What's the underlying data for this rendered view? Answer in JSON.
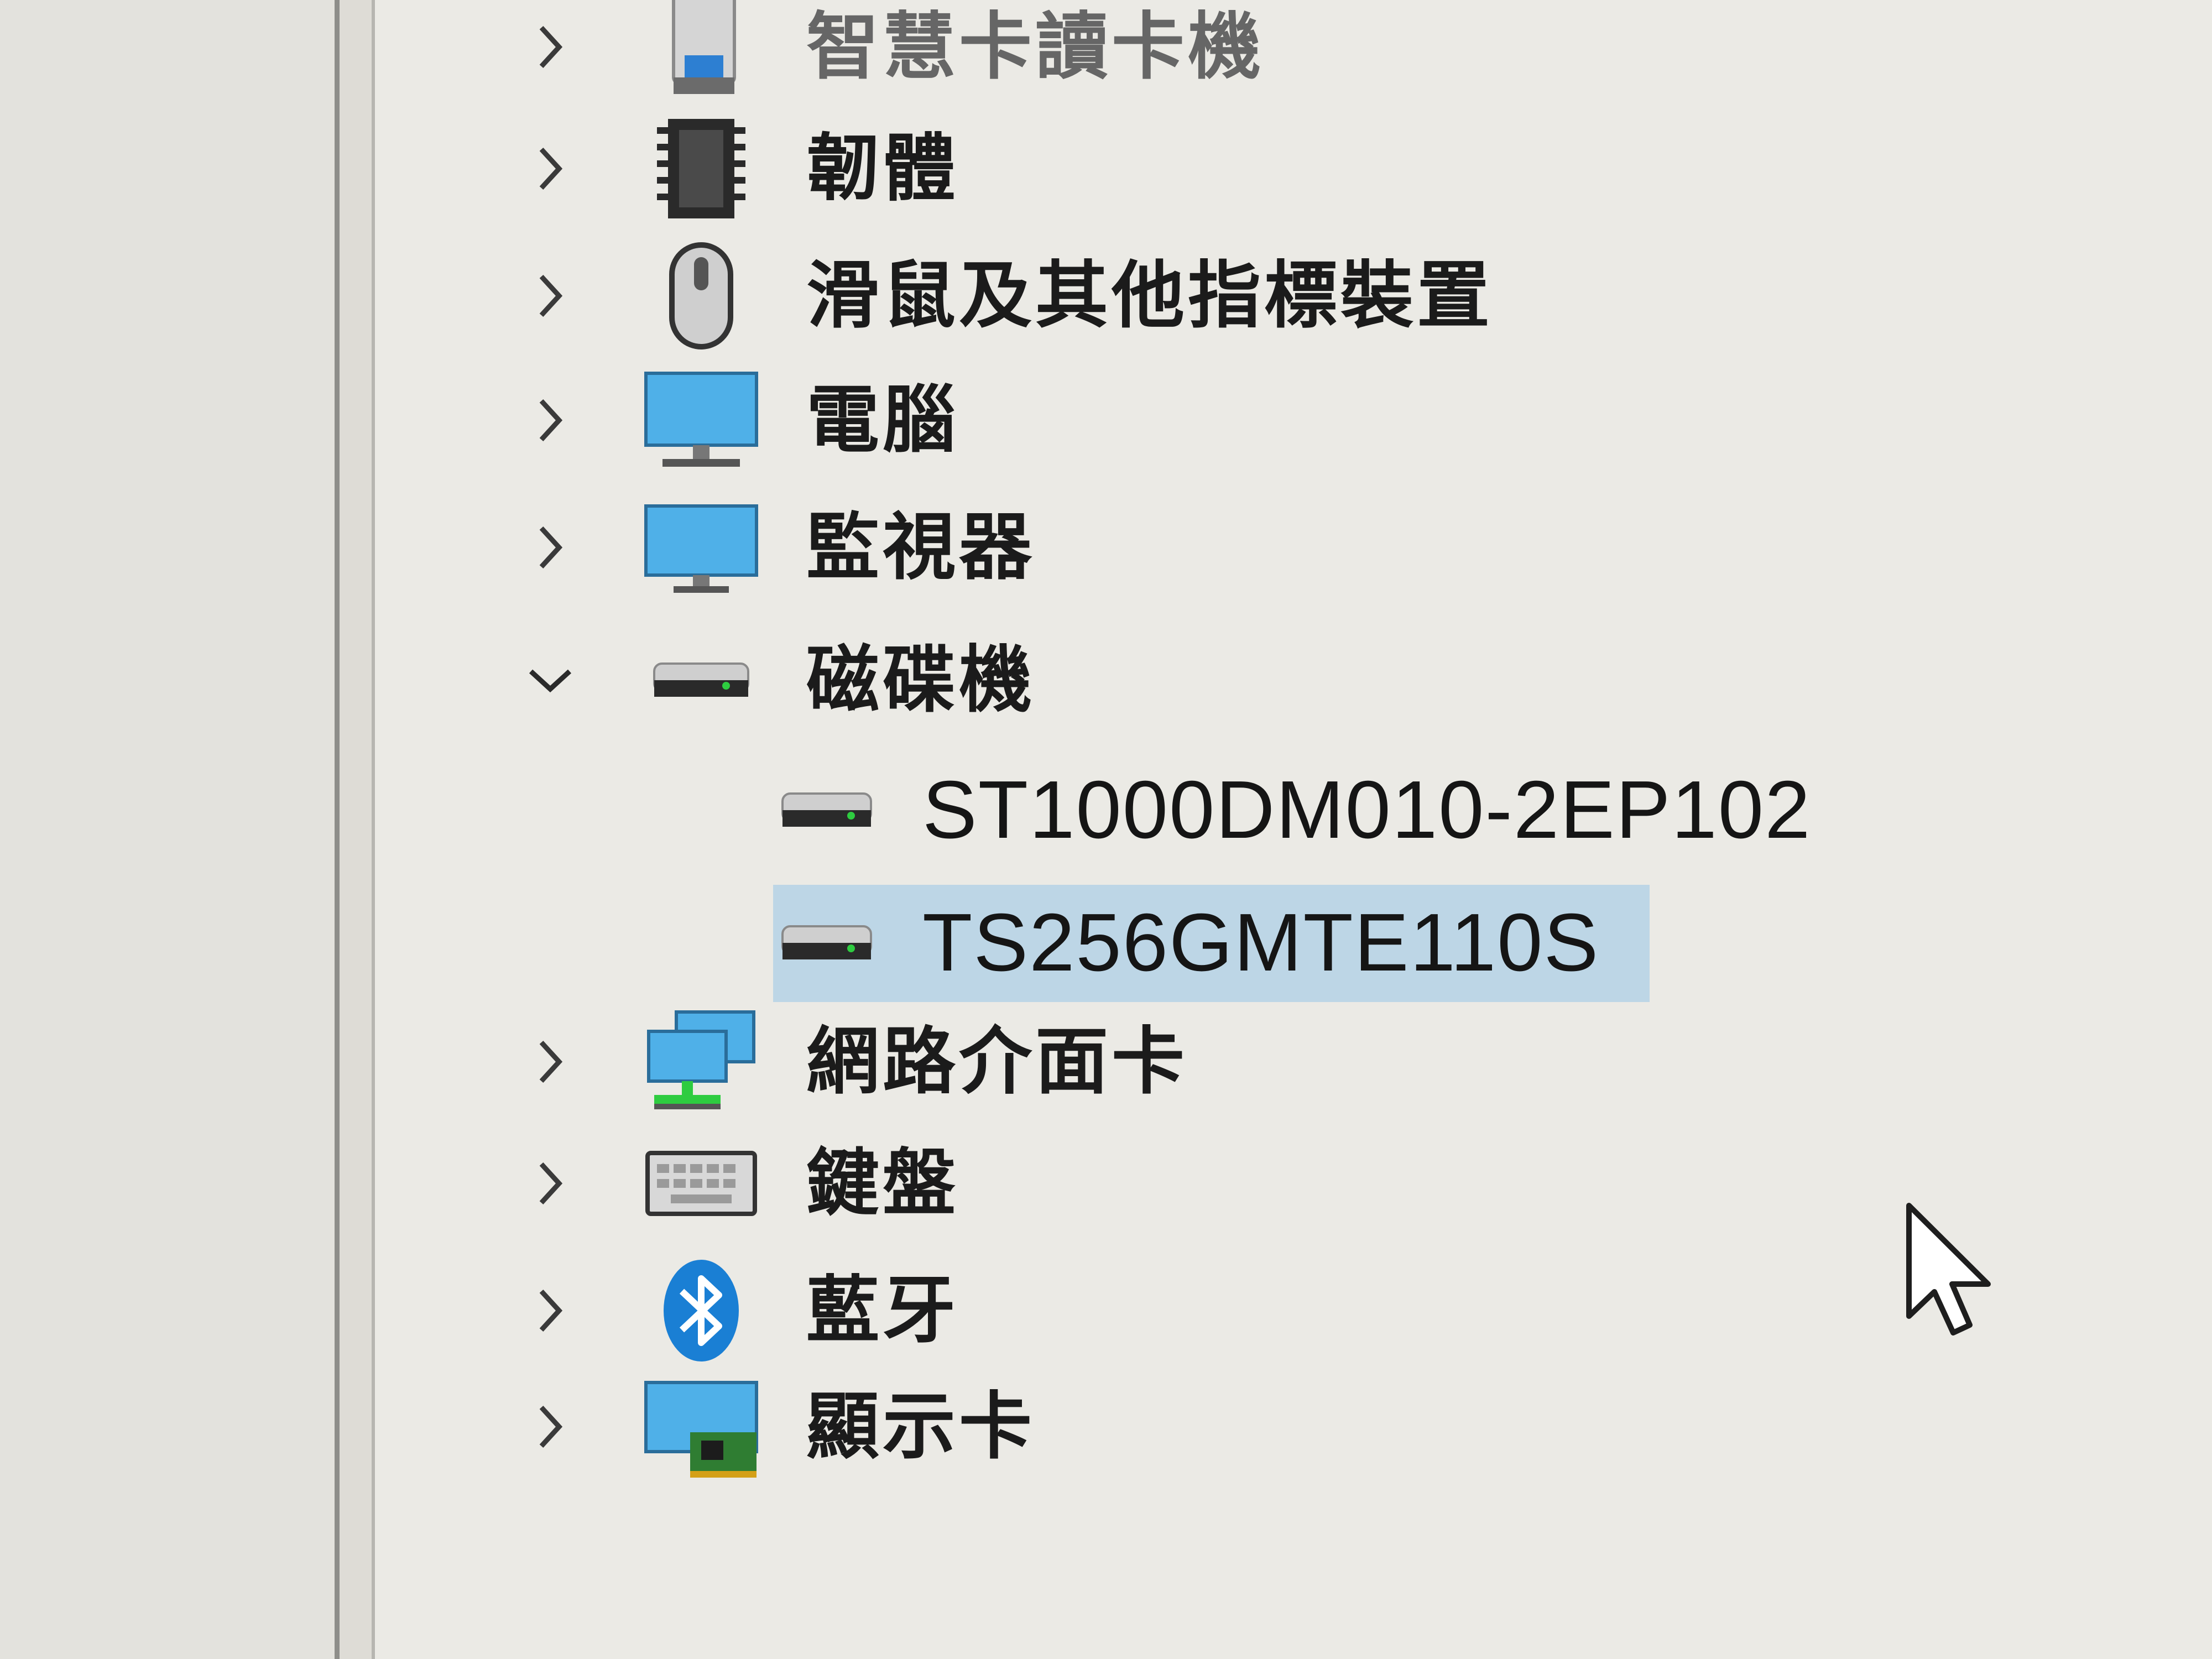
{
  "device_manager_tree": {
    "categories_above": [
      {
        "label": "智慧卡讀卡機",
        "icon": "smart-card-reader-icon",
        "expanded": false
      },
      {
        "label": "韌體",
        "icon": "firmware-chip-icon",
        "expanded": false
      },
      {
        "label": "滑鼠及其他指標裝置",
        "icon": "mouse-icon",
        "expanded": false
      },
      {
        "label": "電腦",
        "icon": "computer-icon",
        "expanded": false
      },
      {
        "label": "監視器",
        "icon": "monitor-icon",
        "expanded": false
      }
    ],
    "disk_drives": {
      "label": "磁碟機",
      "icon": "disk-drive-icon",
      "expanded": true,
      "children": [
        {
          "label": "ST1000DM010-2EP102",
          "icon": "disk-drive-icon",
          "selected": false
        },
        {
          "label": "TS256GMTE110S",
          "icon": "disk-drive-icon",
          "selected": true
        }
      ]
    },
    "categories_below": [
      {
        "label": "網路介面卡",
        "icon": "network-adapter-icon",
        "expanded": false
      },
      {
        "label": "鍵盤",
        "icon": "keyboard-icon",
        "expanded": false
      },
      {
        "label": "藍牙",
        "icon": "bluetooth-icon",
        "expanded": false
      },
      {
        "label": "顯示卡",
        "icon": "display-adapter-icon",
        "expanded": false
      }
    ]
  },
  "colors": {
    "selection": "#bdd6e6",
    "background": "#ebeae5",
    "text": "#1b1b1b",
    "accent_blue": "#1a7fd4"
  }
}
